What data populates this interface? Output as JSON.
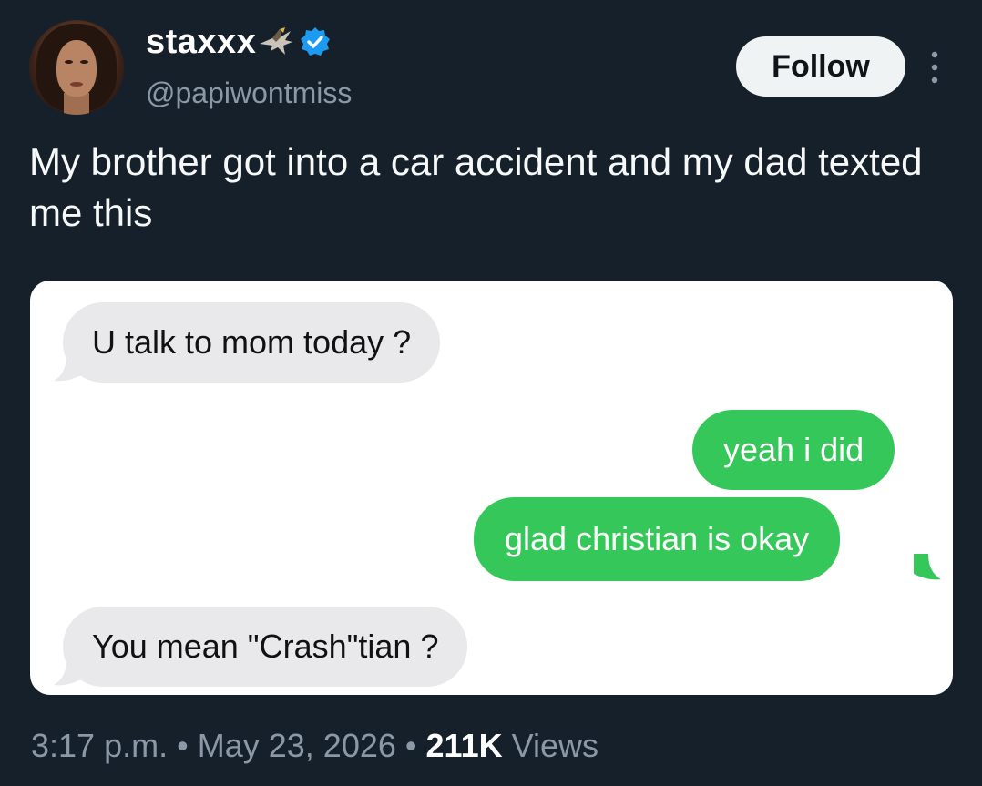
{
  "author": {
    "display_name": "staxxx",
    "handle": "@papiwontmiss",
    "verified": true
  },
  "header": {
    "follow_label": "Follow",
    "more_icon": "more-vertical-icon"
  },
  "tweet": {
    "text": "My brother got into a car accident and my dad texted me this"
  },
  "media": {
    "messages": [
      {
        "side": "incoming",
        "text": "U talk to mom today ?"
      },
      {
        "side": "outgoing",
        "text": "yeah i did"
      },
      {
        "side": "outgoing",
        "text": "glad christian is okay"
      },
      {
        "side": "incoming",
        "text": "You mean \"Crash\"tian ?"
      }
    ]
  },
  "footer": {
    "time": "3:17 p.m.",
    "separator": "•",
    "date": "May 23, 2026",
    "views_count": "211K",
    "views_label": "Views"
  },
  "colors": {
    "background": "#15202b",
    "verified_blue": "#1d9bf0",
    "imessage_green": "#35c759",
    "incoming_gray": "#e9e9eb",
    "muted_text": "#8b98a5"
  }
}
